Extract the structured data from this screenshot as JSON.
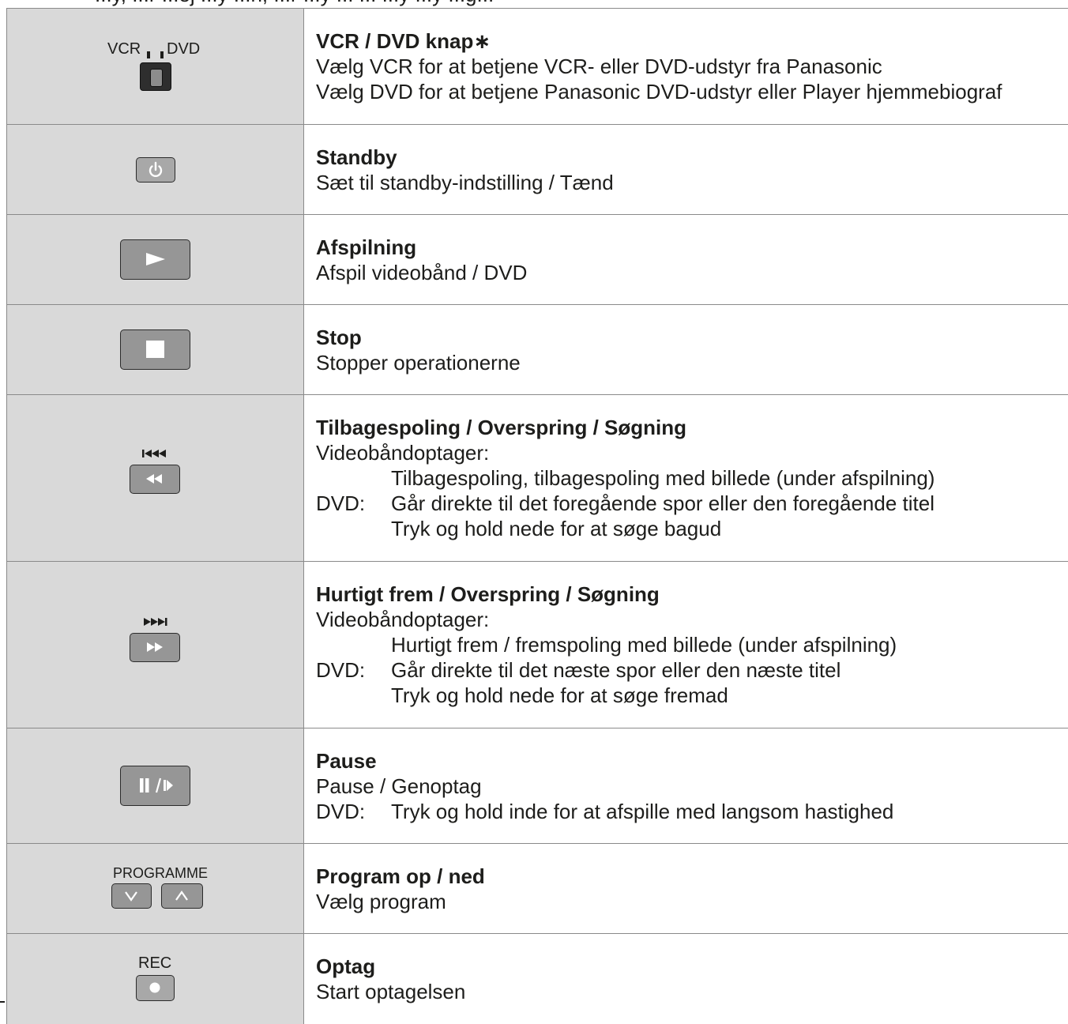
{
  "top_fragment": "...y, ...r  ...ej ...y ...n, ...r ...y ... ... ...y ...y ...g...",
  "rows": [
    {
      "icon": "vcr-dvd-switch-icon",
      "icon_label_left": "VCR",
      "icon_label_right": "DVD",
      "title": "VCR / DVD knap∗",
      "lines": [
        "Vælg VCR for at betjene VCR- eller DVD-udstyr fra Panasonic",
        "Vælg DVD for at betjene Panasonic DVD-udstyr eller Player hjemmebiograf"
      ]
    },
    {
      "icon": "power-icon",
      "title": "Standby",
      "lines": [
        "Sæt til standby-indstilling / Tænd"
      ]
    },
    {
      "icon": "play-icon",
      "title": "Afspilning",
      "lines": [
        "Afspil videobånd / DVD"
      ]
    },
    {
      "icon": "stop-icon",
      "title": "Stop",
      "lines": [
        "Stopper operationerne"
      ]
    },
    {
      "icon": "rewind-skip-back-icon",
      "title": "Tilbagespoling / Overspring / Søgning",
      "vcr_label": "Videobåndoptager:",
      "vcr_text": "Tilbagespoling, tilbagespoling med billede (under afspilning)",
      "dvd_label": "DVD:",
      "dvd_text": "Går direkte til det foregående spor eller den foregående titel",
      "dvd_text2": "Tryk og hold nede for at søge bagud"
    },
    {
      "icon": "fast-forward-skip-icon",
      "title": "Hurtigt frem / Overspring / Søgning",
      "vcr_label": "Videobåndoptager:",
      "vcr_text": "Hurtigt frem / fremspoling med billede (under afspilning)",
      "dvd_label": "DVD:",
      "dvd_text": "Går direkte til det næste spor eller den næste titel",
      "dvd_text2": "Tryk og hold nede for at søge fremad"
    },
    {
      "icon": "pause-slow-icon",
      "title": "Pause",
      "line1": "Pause / Genoptag",
      "dvd_label": "DVD:",
      "dvd_text": "Tryk og hold inde for at afspille med langsom hastighed"
    },
    {
      "icon": "programme-up-down-icon",
      "icon_label": "PROGRAMME",
      "title": "Program op / ned",
      "lines": [
        "Vælg program"
      ]
    },
    {
      "icon": "record-icon",
      "icon_label": "REC",
      "title": "Optag",
      "lines": [
        "Start optagelsen"
      ]
    }
  ]
}
